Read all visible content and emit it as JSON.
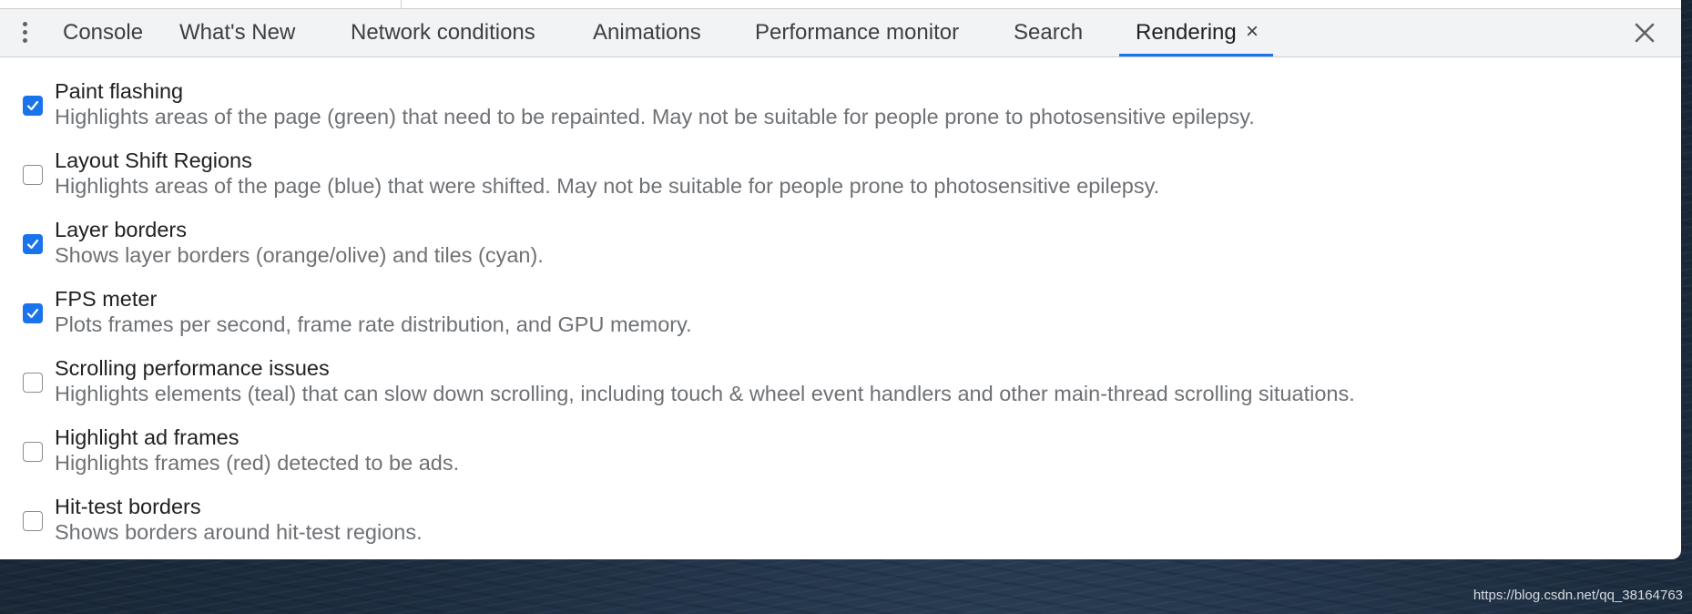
{
  "tabs": [
    {
      "label": "Console"
    },
    {
      "label": "What's New"
    },
    {
      "label": "Network conditions"
    },
    {
      "label": "Animations"
    },
    {
      "label": "Performance monitor"
    },
    {
      "label": "Search"
    },
    {
      "label": "Rendering",
      "active": true
    }
  ],
  "active_tab_close": "×",
  "accent_color": "#1a73e8",
  "icons": {
    "more": "kebab-menu-icon",
    "close_drawer": "close-icon",
    "checkmark": "checkmark-icon"
  },
  "rendering_options": [
    {
      "title": "Paint flashing",
      "description": "Highlights areas of the page (green) that need to be repainted. May not be suitable for people prone to photosensitive epilepsy.",
      "checked": true
    },
    {
      "title": "Layout Shift Regions",
      "description": "Highlights areas of the page (blue) that were shifted. May not be suitable for people prone to photosensitive epilepsy.",
      "checked": false
    },
    {
      "title": "Layer borders",
      "description": "Shows layer borders (orange/olive) and tiles (cyan).",
      "checked": true
    },
    {
      "title": "FPS meter",
      "description": "Plots frames per second, frame rate distribution, and GPU memory.",
      "checked": true
    },
    {
      "title": "Scrolling performance issues",
      "description": "Highlights elements (teal) that can slow down scrolling, including touch & wheel event handlers and other main-thread scrolling situations.",
      "checked": false
    },
    {
      "title": "Highlight ad frames",
      "description": "Highlights frames (red) detected to be ads.",
      "checked": false
    },
    {
      "title": "Hit-test borders",
      "description": "Shows borders around hit-test regions.",
      "checked": false
    }
  ],
  "watermark": "https://blog.csdn.net/qq_38164763"
}
